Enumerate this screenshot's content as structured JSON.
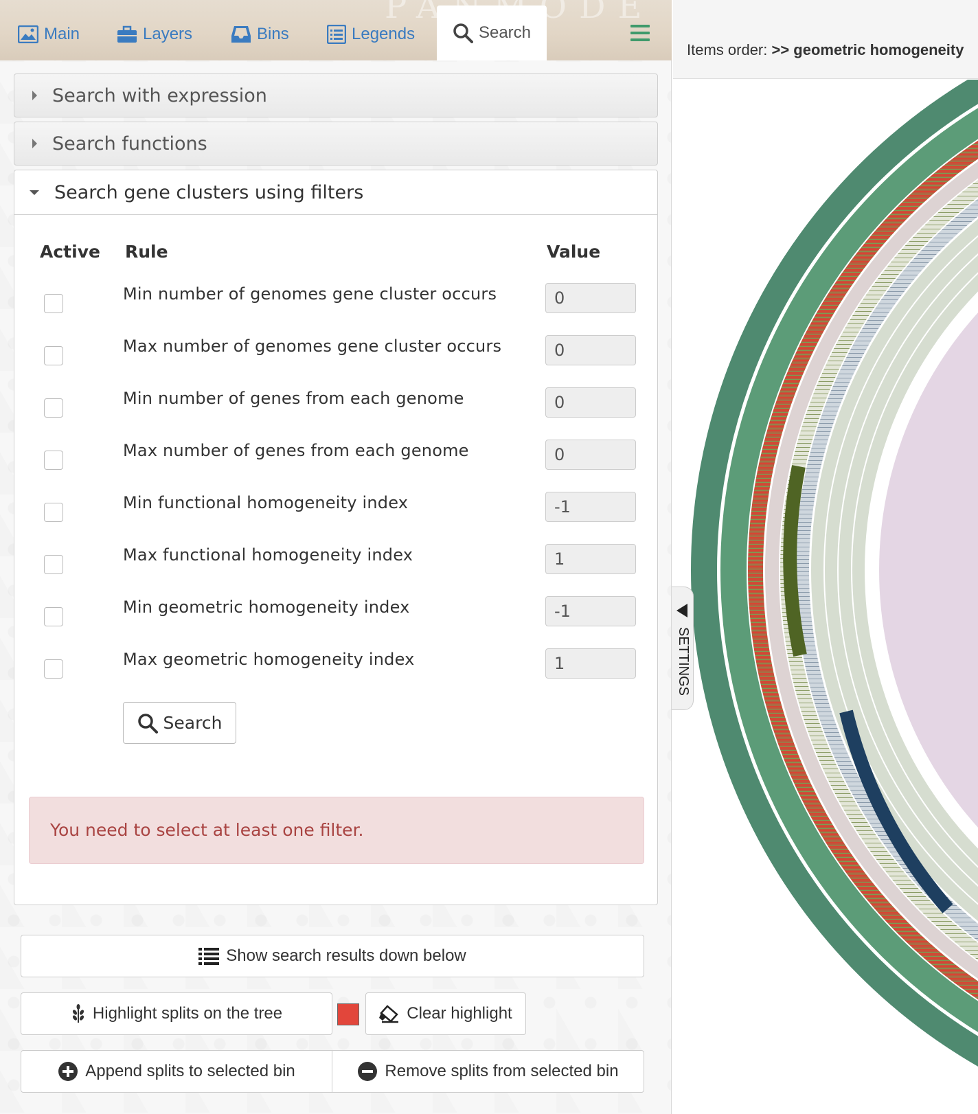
{
  "tabs": [
    {
      "label": "Main",
      "icon": "image-icon"
    },
    {
      "label": "Layers",
      "icon": "briefcase-icon"
    },
    {
      "label": "Bins",
      "icon": "inbox-icon"
    },
    {
      "label": "Legends",
      "icon": "list-alt-icon"
    },
    {
      "label": "Search",
      "icon": "search-icon",
      "active": true
    }
  ],
  "accordion": {
    "expression": "Search with expression",
    "functions": "Search functions",
    "filters": "Search gene clusters using filters"
  },
  "filters": {
    "headers": {
      "active": "Active",
      "rule": "Rule",
      "value": "Value"
    },
    "rows": [
      {
        "rule": "Min number of genomes gene cluster occurs",
        "value": "0",
        "active": false
      },
      {
        "rule": "Max number of genomes gene cluster occurs",
        "value": "0",
        "active": false
      },
      {
        "rule": "Min number of genes from each genome",
        "value": "0",
        "active": false
      },
      {
        "rule": "Max number of genes from each genome",
        "value": "0",
        "active": false
      },
      {
        "rule": "Min functional homogeneity index",
        "value": "-1",
        "active": false
      },
      {
        "rule": "Max functional homogeneity index",
        "value": "1",
        "active": false
      },
      {
        "rule": "Min geometric homogeneity index",
        "value": "-1",
        "active": false
      },
      {
        "rule": "Max geometric homogeneity index",
        "value": "1",
        "active": false
      }
    ],
    "search_button": "Search",
    "alert": "You need to select at least one filter."
  },
  "actions": {
    "show_results": "Show search results down below",
    "highlight": "Highlight splits on the tree",
    "highlight_color": "#e2463b",
    "clear": "Clear highlight",
    "append": "Append splits to selected bin",
    "remove": "Remove splits from selected bin"
  },
  "right": {
    "order_label": "Items order:",
    "order_value": ">> geometric homogeneity"
  },
  "settings_tab": "SETTINGS",
  "colors": {
    "accent": "#3a7bc0",
    "menu": "#3f9a6b",
    "alert_text": "#a94442",
    "alert_bg": "#f2dede"
  }
}
